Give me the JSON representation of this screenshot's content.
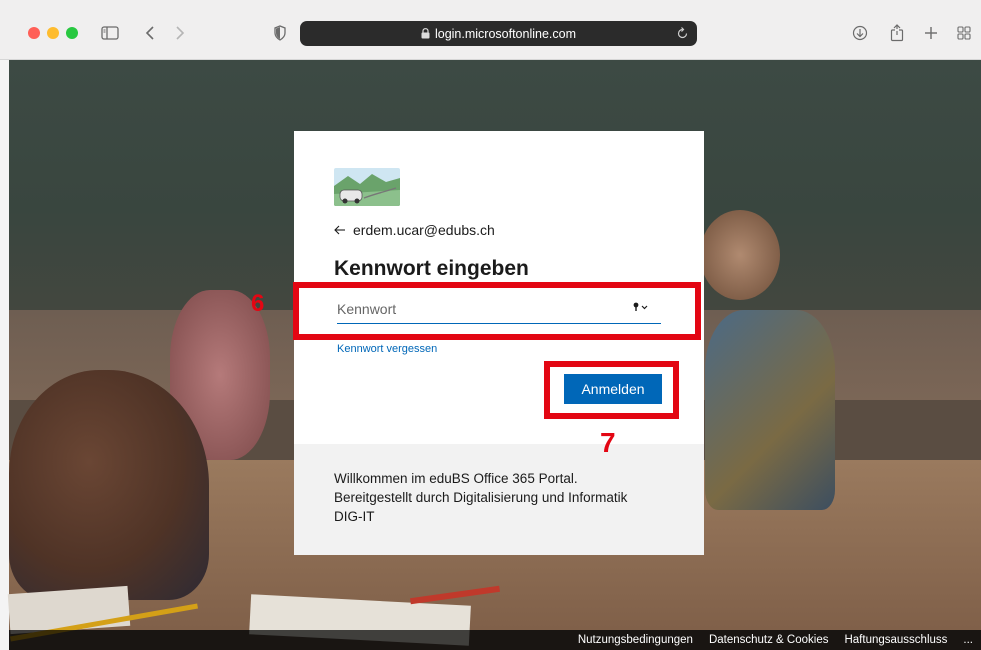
{
  "browser": {
    "url": "login.microsoftonline.com"
  },
  "login": {
    "identity": "erdem.ucar@edubs.ch",
    "title": "Kennwort eingeben",
    "password_placeholder": "Kennwort",
    "forgot_link": "Kennwort vergessen",
    "signin_button": "Anmelden",
    "footer_lines": [
      "Willkommen im eduBS Office 365 Portal.",
      "Bereitgestellt durch Digitalisierung und Informatik",
      "DIG-IT"
    ]
  },
  "annotations": {
    "step_password": "6",
    "step_signin": "7",
    "color": "#e30613"
  },
  "page_footer": {
    "links": [
      "Nutzungsbedingungen",
      "Datenschutz & Cookies",
      "Haftungsausschluss",
      "..."
    ]
  },
  "colors": {
    "accent": "#0067b8"
  },
  "icons": {
    "toolbar": [
      "sidebar-icon",
      "back-icon",
      "forward-icon",
      "shield-icon",
      "lock-icon",
      "reload-icon",
      "download-icon",
      "share-icon",
      "new-tab-icon",
      "tab-overview-icon"
    ],
    "login": [
      "back-arrow-icon",
      "key-icon"
    ]
  }
}
